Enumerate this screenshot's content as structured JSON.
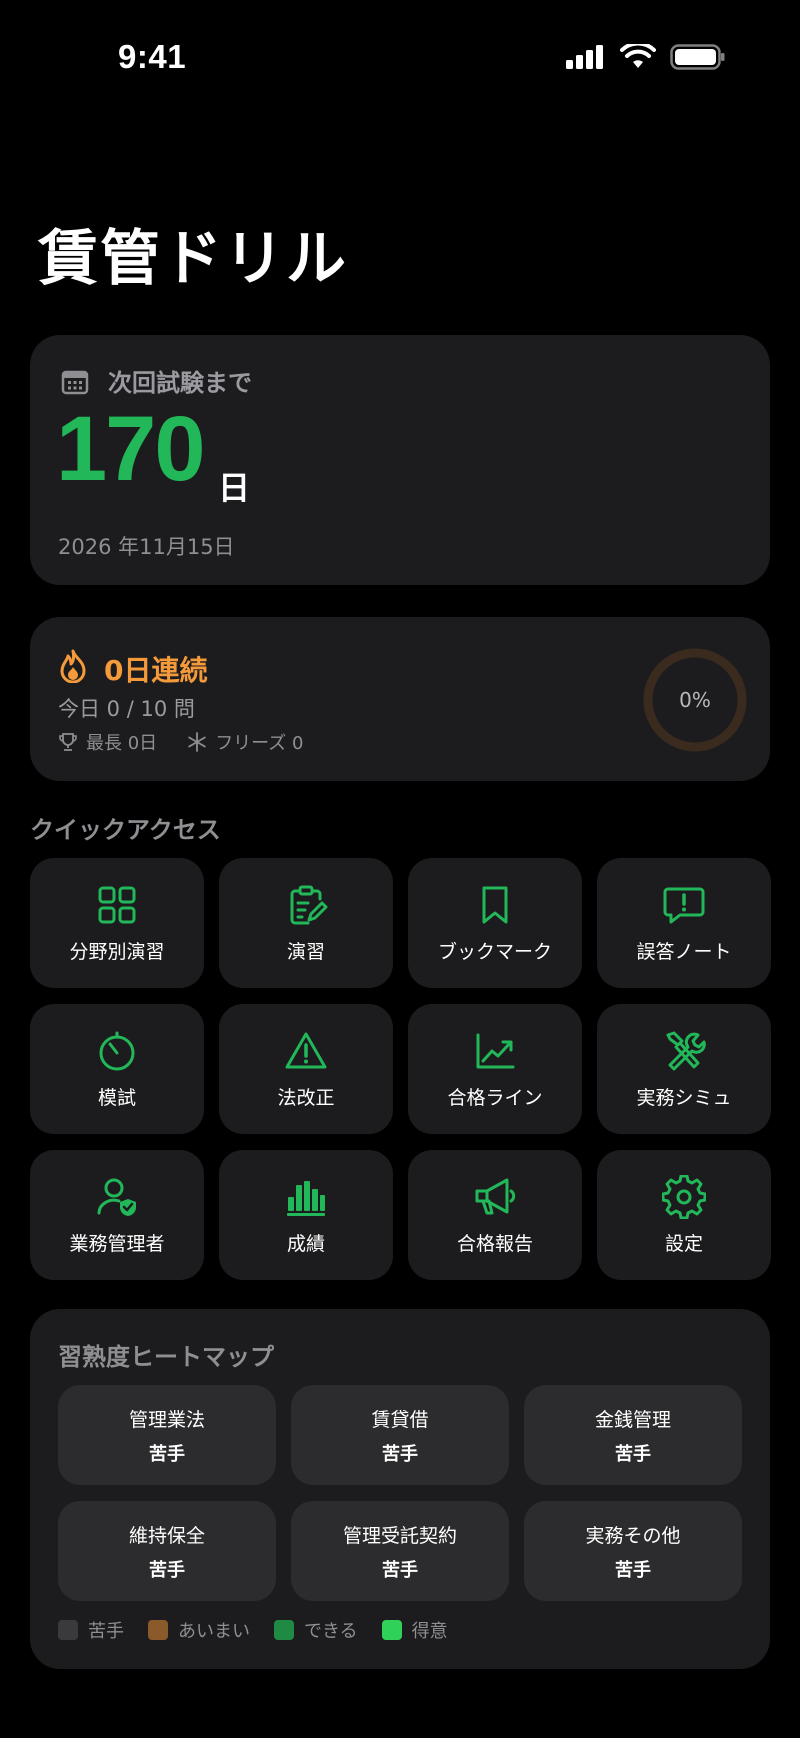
{
  "status_bar": {
    "time": "9:41"
  },
  "app": {
    "title": "賃管ドリル"
  },
  "countdown": {
    "label": "次回試験まで",
    "days": "170",
    "unit": "日",
    "date": "2026 年11月15日"
  },
  "streak": {
    "title": "0日連続",
    "today": "今日 0 / 10 問",
    "longest": "最長 0日",
    "freeze": "フリーズ 0",
    "progress_percent": 0,
    "progress_label": "0%"
  },
  "quick_access": {
    "title": "クイックアクセス",
    "items": [
      {
        "label": "分野別演習",
        "icon": "grid-icon"
      },
      {
        "label": "演習",
        "icon": "clipboard-edit-icon"
      },
      {
        "label": "ブックマーク",
        "icon": "bookmark-icon"
      },
      {
        "label": "誤答ノート",
        "icon": "alert-bubble-icon"
      },
      {
        "label": "模試",
        "icon": "timer-icon"
      },
      {
        "label": "法改正",
        "icon": "warning-icon"
      },
      {
        "label": "合格ライン",
        "icon": "trend-chart-icon"
      },
      {
        "label": "実務シミュ",
        "icon": "tools-icon"
      },
      {
        "label": "業務管理者",
        "icon": "user-shield-icon"
      },
      {
        "label": "成績",
        "icon": "bar-chart-icon"
      },
      {
        "label": "合格報告",
        "icon": "megaphone-icon"
      },
      {
        "label": "設定",
        "icon": "gear-icon"
      }
    ]
  },
  "heatmap": {
    "title": "習熟度ヒートマップ",
    "cells": [
      {
        "name": "管理業法",
        "level": "苦手"
      },
      {
        "name": "賃貸借",
        "level": "苦手"
      },
      {
        "name": "金銭管理",
        "level": "苦手"
      },
      {
        "name": "維持保全",
        "level": "苦手"
      },
      {
        "name": "管理受託契約",
        "level": "苦手"
      },
      {
        "name": "実務その他",
        "level": "苦手"
      }
    ],
    "legend": [
      {
        "label": "苦手",
        "color": "#3a3a3c"
      },
      {
        "label": "あいまい",
        "color": "#8a5a2b"
      },
      {
        "label": "できる",
        "color": "#1f8a44"
      },
      {
        "label": "得意",
        "color": "#2fd158"
      }
    ]
  },
  "colors": {
    "accent": "#22b859",
    "streak": "#f59a3b",
    "card": "#1c1c1e"
  }
}
